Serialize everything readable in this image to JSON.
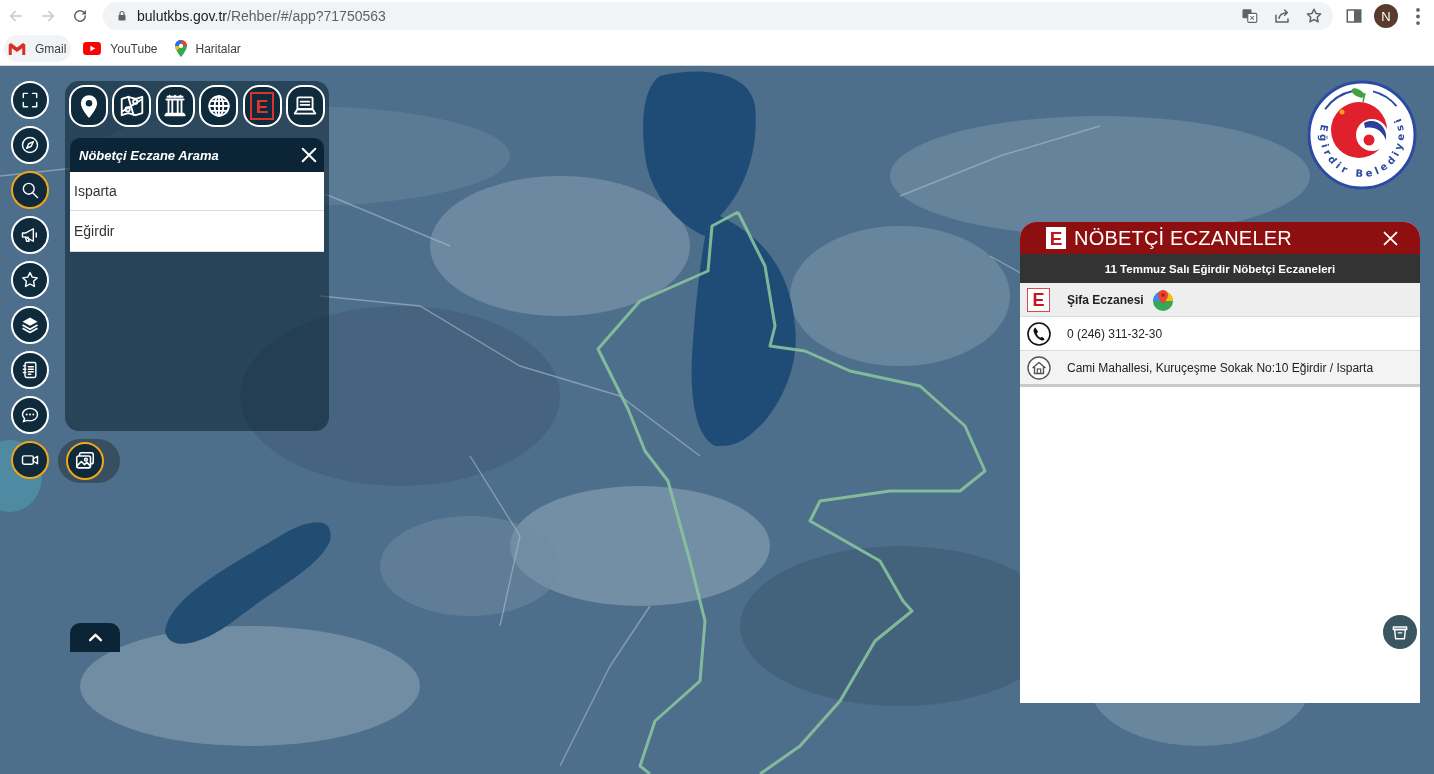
{
  "browser": {
    "nav": {
      "back_disabled": true,
      "forward_disabled": true
    },
    "address": {
      "host": "bulutkbs.gov.tr",
      "path": "/Rehber/#/app?71750563"
    },
    "profile_initial": "N",
    "bookmarks": [
      {
        "label": "Gmail",
        "highlighted": true
      },
      {
        "label": "YouTube",
        "highlighted": false
      },
      {
        "label": "Haritalar",
        "highlighted": false
      }
    ]
  },
  "left_toolbar": [
    {
      "active": false
    },
    {
      "active": false
    },
    {
      "active": true
    },
    {
      "active": false
    },
    {
      "active": false
    },
    {
      "active": false
    },
    {
      "active": false
    },
    {
      "active": false
    },
    {
      "active": true
    }
  ],
  "media_menu": [
    {
      "active": true
    }
  ],
  "top_toolbar": {
    "pharmacy_badge": "E"
  },
  "search_panel": {
    "title": "Nöbetçi Eczane Arama",
    "fields": [
      {
        "value": "Isparta"
      },
      {
        "value": "Eğirdir"
      }
    ]
  },
  "logo": {
    "text": "Eğirdir Belediyesi"
  },
  "duty_panel": {
    "badge": "E",
    "title": "NÖBETÇİ ECZANELER",
    "subtitle": "11 Temmuz Salı Eğirdir Nöbetçi Eczaneleri",
    "pharmacies": [
      {
        "badge": "E",
        "name": "Şifa Eczanesi",
        "phone": "0 (246) 311-32-30",
        "address": "Cami Mahallesi, Kuruçeşme Sokak No:10 Eğirdir / Isparta"
      }
    ]
  }
}
